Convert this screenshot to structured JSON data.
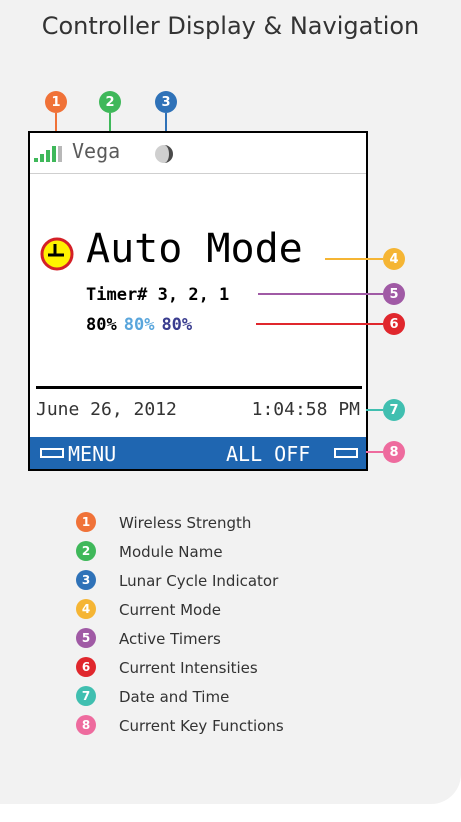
{
  "title": "Controller Display & Navigation",
  "colors": {
    "c1": "#f07238",
    "c2": "#3fb85a",
    "c3": "#2f72b8",
    "c4": "#f5b534",
    "c5": "#a05aa5",
    "c6": "#e0272d",
    "c7": "#40bfb0",
    "c8": "#ee6b9e",
    "soft_bar": "#1f66b1",
    "intensity_1": "#000000",
    "intensity_2": "#5aa6dc",
    "intensity_3": "#3a3d8f"
  },
  "screen": {
    "module_name": "Vega",
    "mode": "Auto Mode",
    "timers": "Timer# 3, 2, 1",
    "intensities": [
      "80%",
      "80%",
      "80%"
    ],
    "date": "June 26, 2012",
    "time": "1:04:58 PM",
    "menu_key": "MENU",
    "alloff_key": "ALL OFF",
    "icons": [
      "signal-strength-icon",
      "moon-icon",
      "clock-icon"
    ]
  },
  "badges": [
    "1",
    "2",
    "3",
    "4",
    "5",
    "6",
    "7",
    "8"
  ],
  "legend": [
    {
      "num": "1",
      "label": "Wireless Strength"
    },
    {
      "num": "2",
      "label": "Module Name"
    },
    {
      "num": "3",
      "label": "Lunar Cycle Indicator"
    },
    {
      "num": "4",
      "label": "Current Mode"
    },
    {
      "num": "5",
      "label": "Active Timers"
    },
    {
      "num": "6",
      "label": "Current Intensities"
    },
    {
      "num": "7",
      "label": "Date and Time"
    },
    {
      "num": "8",
      "label": "Current Key Functions"
    }
  ]
}
